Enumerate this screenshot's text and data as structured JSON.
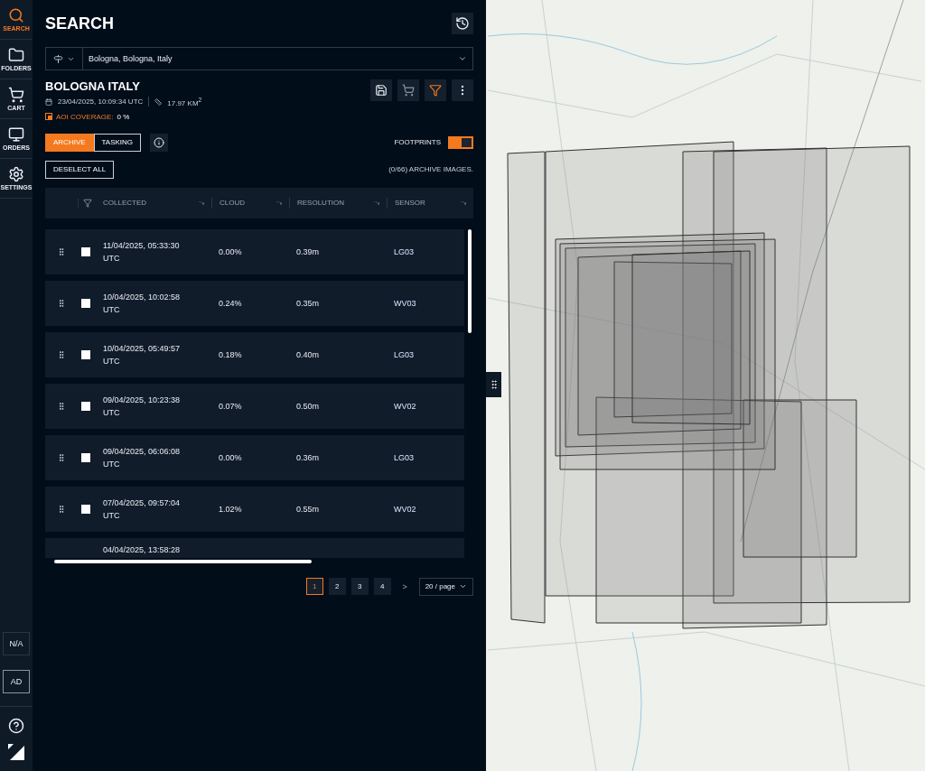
{
  "rail": {
    "items": [
      {
        "kind": "search",
        "label": "SEARCH",
        "selected": true
      },
      {
        "kind": "folders",
        "label": "FOLDERS",
        "selected": false
      },
      {
        "kind": "cart",
        "label": "CART",
        "selected": false
      },
      {
        "kind": "orders",
        "label": "ORDERS",
        "selected": false
      },
      {
        "kind": "settings",
        "label": "SETTINGS",
        "selected": false
      }
    ],
    "badges": [
      "N/A",
      "AD"
    ]
  },
  "panel": {
    "title": "SEARCH",
    "location": "Bologna, Bologna, Italy",
    "aoi": {
      "name": "BOLOGNA ITALY",
      "date": "23/04/2025, 10:09:34 UTC",
      "area": "17.97 KM$^{2}$",
      "coverage_label": "AOI COVERAGE:",
      "coverage_value": "0 %"
    },
    "mode_tabs": [
      {
        "label": "ARCHIVE",
        "selected": true
      },
      {
        "label": "TASKING",
        "selected": false
      }
    ],
    "footprints": {
      "label": "FOOTPRINTS",
      "on": true
    },
    "deselect": "DESELECT ALL",
    "count": "(0/66) ARCHIVE IMAGES.",
    "table": {
      "columns": [
        "COLLECTED",
        "CLOUD",
        "RESOLUTION",
        "SENSOR"
      ],
      "rows": [
        {
          "collected": "11/04/2025, 05:33:30 UTC",
          "cloud": "0.00%",
          "resolution": "0.39m",
          "sensor": "LG03",
          "checked": false
        },
        {
          "collected": "10/04/2025, 10:02:58 UTC",
          "cloud": "0.24%",
          "resolution": "0.35m",
          "sensor": "WV03",
          "checked": false
        },
        {
          "collected": "10/04/2025, 05:49:57 UTC",
          "cloud": "0.18%",
          "resolution": "0.40m",
          "sensor": "LG03",
          "checked": false
        },
        {
          "collected": "09/04/2025, 10:23:38 UTC",
          "cloud": "0.07%",
          "resolution": "0.50m",
          "sensor": "WV02",
          "checked": false
        },
        {
          "collected": "09/04/2025, 06:06:08 UTC",
          "cloud": "0.00%",
          "resolution": "0.36m",
          "sensor": "LG03",
          "checked": false
        },
        {
          "collected": "07/04/2025, 09:57:04 UTC",
          "cloud": "1.02%",
          "resolution": "0.55m",
          "sensor": "WV02",
          "checked": false
        },
        {
          "kind": "cut",
          "collected": "04/04/2025, 13:58:28"
        }
      ]
    },
    "pages": [
      {
        "label": "1",
        "selected": true
      },
      {
        "label": "2",
        "selected": false
      },
      {
        "label": "3",
        "selected": false
      },
      {
        "label": "4",
        "selected": false
      }
    ],
    "next": ">",
    "page_size": "20 / page"
  }
}
